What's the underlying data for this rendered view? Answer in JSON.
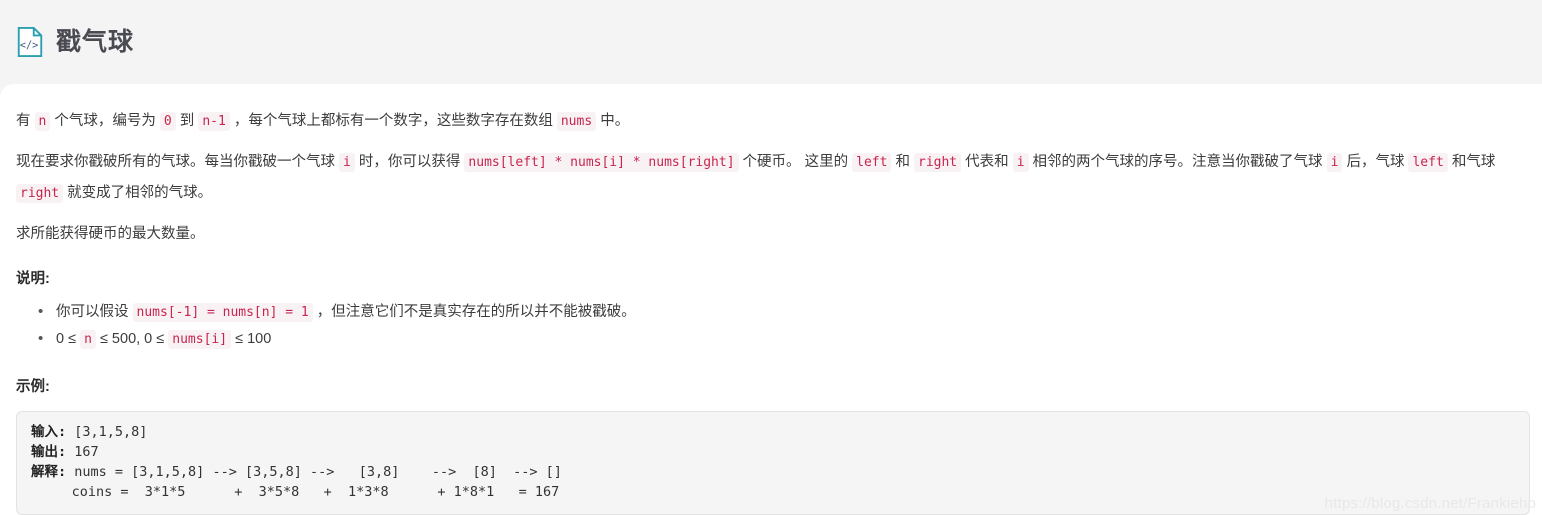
{
  "header": {
    "icon": "code-file-icon",
    "icon_color": "#2aa0ae",
    "title": "戳气球"
  },
  "content": {
    "paragraphs": [
      {
        "id": "intro",
        "segments": [
          {
            "type": "text",
            "value": "有 "
          },
          {
            "type": "code",
            "value": "n"
          },
          {
            "type": "text",
            "value": " 个气球，编号为 "
          },
          {
            "type": "code",
            "value": "0"
          },
          {
            "type": "text",
            "value": " 到 "
          },
          {
            "type": "code",
            "value": "n-1"
          },
          {
            "type": "text",
            "value": " ，每个气球上都标有一个数字，这些数字存在数组 "
          },
          {
            "type": "code",
            "value": "nums"
          },
          {
            "type": "text",
            "value": " 中。"
          }
        ]
      },
      {
        "id": "rules",
        "segments": [
          {
            "type": "text",
            "value": "现在要求你戳破所有的气球。每当你戳破一个气球 "
          },
          {
            "type": "code",
            "value": "i"
          },
          {
            "type": "text",
            "value": " 时，你可以获得 "
          },
          {
            "type": "code",
            "value": "nums[left] * nums[i] * nums[right]"
          },
          {
            "type": "text",
            "value": " 个硬币。 这里的 "
          },
          {
            "type": "code",
            "value": "left"
          },
          {
            "type": "text",
            "value": " 和 "
          },
          {
            "type": "code",
            "value": "right"
          },
          {
            "type": "text",
            "value": " 代表和 "
          },
          {
            "type": "code",
            "value": "i"
          },
          {
            "type": "text",
            "value": " 相邻的两个气球的序号。注意当你戳破了气球 "
          },
          {
            "type": "code",
            "value": "i"
          },
          {
            "type": "text",
            "value": " 后，气球 "
          },
          {
            "type": "code",
            "value": "left"
          },
          {
            "type": "text",
            "value": " 和气球 "
          },
          {
            "type": "code",
            "value": "right"
          },
          {
            "type": "text",
            "value": " 就变成了相邻的气球。"
          }
        ]
      },
      {
        "id": "goal",
        "segments": [
          {
            "type": "text",
            "value": "求所能获得硬币的最大数量。"
          }
        ]
      }
    ],
    "notes_label": "说明:",
    "notes": [
      {
        "segments": [
          {
            "type": "text",
            "value": "你可以假设 "
          },
          {
            "type": "code",
            "value": "nums[-1] = nums[n] = 1"
          },
          {
            "type": "text",
            "value": " ，但注意它们不是真实存在的所以并不能被戳破。"
          }
        ]
      },
      {
        "segments": [
          {
            "type": "text",
            "value": "0 ≤ "
          },
          {
            "type": "code",
            "value": "n"
          },
          {
            "type": "text",
            "value": " ≤ 500, 0 ≤ "
          },
          {
            "type": "code",
            "value": "nums[i]"
          },
          {
            "type": "text",
            "value": " ≤ 100"
          }
        ]
      }
    ],
    "example_label": "示例:",
    "example_code": {
      "input_label": "输入:",
      "input_value": " [3,1,5,8]",
      "output_label": "输出:",
      "output_value": " 167",
      "explain_label": "解释:",
      "explain_line1": " nums = [3,1,5,8] --> [3,5,8] -->   [3,8]    -->  [8]  --> []",
      "explain_line2": "     coins =  3*1*5      +  3*5*8   +  1*3*8      + 1*8*1   = 167"
    }
  },
  "watermark": "https://blog.csdn.net/Frankiehp"
}
